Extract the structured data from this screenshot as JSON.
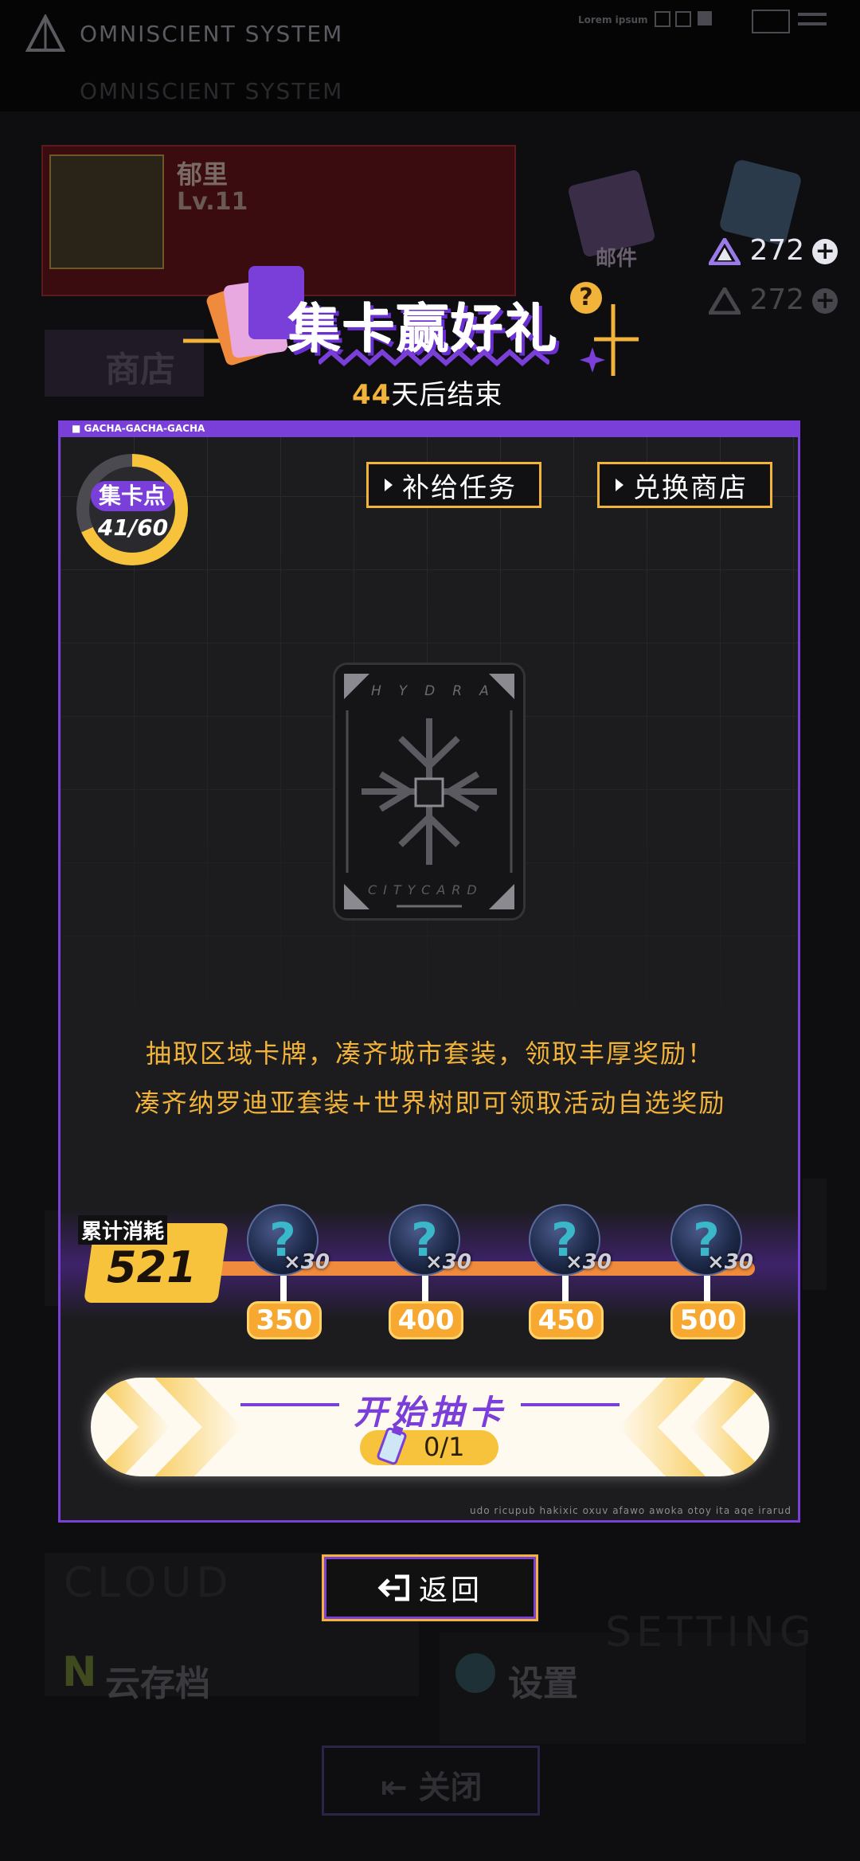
{
  "system": {
    "title": "OMNISCIENT SYSTEM",
    "lorem": "Lorem ipsum"
  },
  "profile": {
    "name": "郁里",
    "level": "Lv.11"
  },
  "mail": {
    "label": "邮件"
  },
  "currency": {
    "amount": "272"
  },
  "shop": {
    "label": "商店"
  },
  "event": {
    "title": "集卡赢好礼",
    "days": "44",
    "end_suffix": "天后结束",
    "help": "?"
  },
  "panel": {
    "tag": "GACHA-GACHA-GACHA",
    "footnote": "udo ricupub hakixic oxuv afawo awoka otoy ita aqe irarud"
  },
  "points": {
    "label": "集卡点",
    "value": "41/60",
    "fraction": 0.6833
  },
  "buttons": {
    "supply_tasks": "补给任务",
    "exchange_shop": "兑换商店",
    "back": "返回"
  },
  "card": {
    "top_text": "HYDRA",
    "bottom_text": "CITYCARD"
  },
  "description": {
    "line1": "抽取区域卡牌，凑齐城市套装，领取丰厚奖励！",
    "line2": "凑齐纳罗迪亚套装+世界树即可领取活动自选奖励"
  },
  "cumulative": {
    "label": "累计消耗",
    "value": "521"
  },
  "milestones": [
    {
      "threshold": "350",
      "qty": "×30"
    },
    {
      "threshold": "400",
      "qty": "×30"
    },
    {
      "threshold": "450",
      "qty": "×30"
    },
    {
      "threshold": "500",
      "qty": "×30"
    }
  ],
  "draw": {
    "label": "开始抽卡",
    "count": "0/1"
  },
  "background": {
    "cloud_big": "CLOUD",
    "cloud_label": "云存档",
    "setting_big": "SETTING",
    "setting_label": "设置",
    "close_label": "关闭"
  },
  "colors": {
    "accent_purple": "#7a3fd8",
    "accent_gold": "#f2b33a",
    "track_orange": "#f08a3c"
  }
}
